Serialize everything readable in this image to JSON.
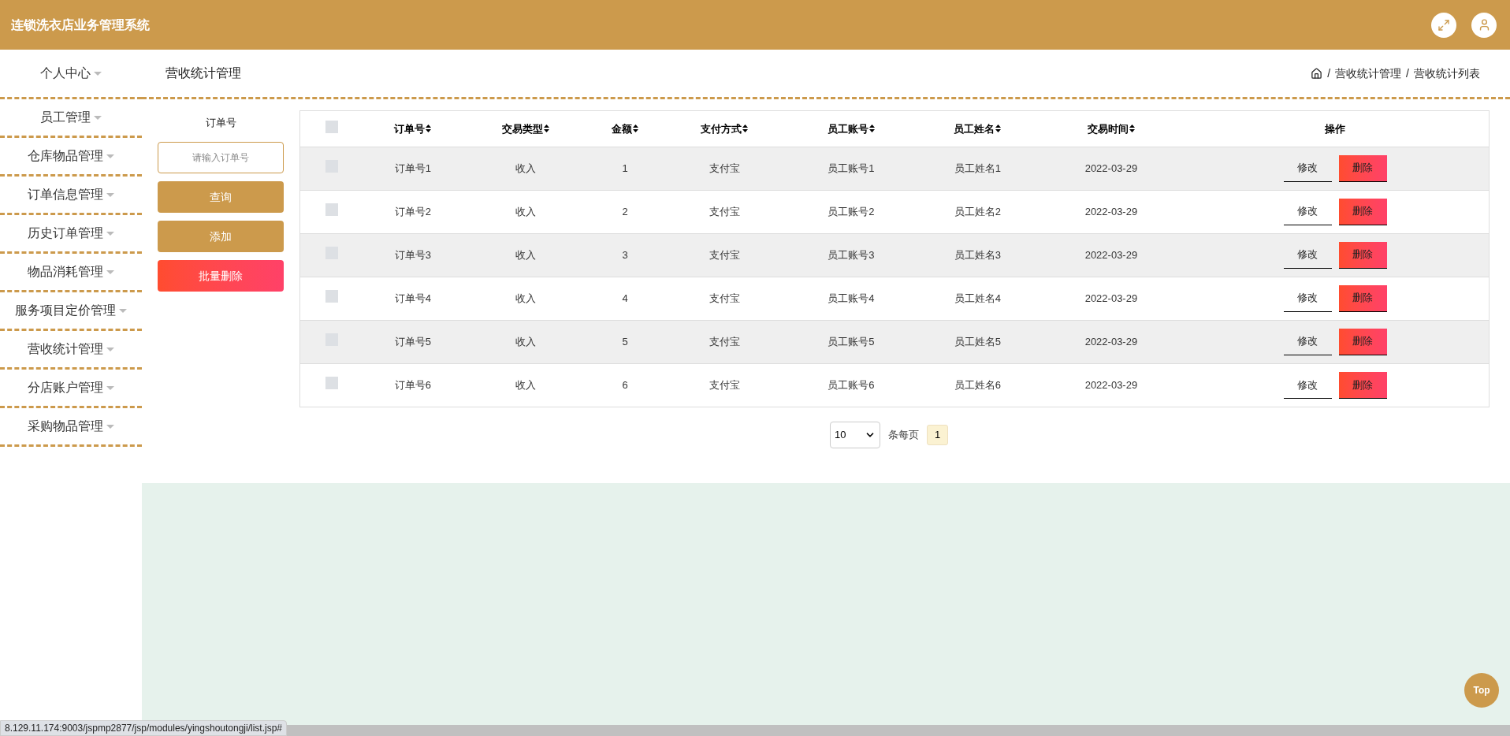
{
  "header": {
    "title": "连锁洗衣店业务管理系统"
  },
  "sidebar": {
    "items": [
      {
        "label": "个人中心"
      },
      {
        "label": "员工管理"
      },
      {
        "label": "仓库物品管理"
      },
      {
        "label": "订单信息管理"
      },
      {
        "label": "历史订单管理"
      },
      {
        "label": "物品消耗管理"
      },
      {
        "label": "服务项目定价管理"
      },
      {
        "label": "营收统计管理"
      },
      {
        "label": "分店账户管理"
      },
      {
        "label": "采购物品管理"
      }
    ]
  },
  "page_title": "营收统计管理",
  "breadcrumb": [
    {
      "separator": "/",
      "label": "营收统计管理"
    },
    {
      "separator": "/",
      "label": "营收统计列表"
    }
  ],
  "filter": {
    "label": "订单号",
    "placeholder": "请输入订单号",
    "buttons": [
      {
        "label": "查询",
        "kind": "primary"
      },
      {
        "label": "添加",
        "kind": "primary"
      },
      {
        "label": "批量删除",
        "kind": "danger"
      }
    ]
  },
  "table": {
    "select_all_checked": false,
    "columns": [
      "订单号",
      "交易类型",
      "金额",
      "支付方式",
      "员工账号",
      "员工姓名",
      "交易时间"
    ],
    "action_column": "操作",
    "rows": [
      {
        "checked": false,
        "cells": [
          "订单号1",
          "收入",
          "1",
          "支付宝",
          "员工账号1",
          "员工姓名1",
          "2022-03-29"
        ],
        "actions": [
          "修改",
          "删除"
        ]
      },
      {
        "checked": false,
        "cells": [
          "订单号2",
          "收入",
          "2",
          "支付宝",
          "员工账号2",
          "员工姓名2",
          "2022-03-29"
        ],
        "actions": [
          "修改",
          "删除"
        ]
      },
      {
        "checked": false,
        "cells": [
          "订单号3",
          "收入",
          "3",
          "支付宝",
          "员工账号3",
          "员工姓名3",
          "2022-03-29"
        ],
        "actions": [
          "修改",
          "删除"
        ]
      },
      {
        "checked": false,
        "cells": [
          "订单号4",
          "收入",
          "4",
          "支付宝",
          "员工账号4",
          "员工姓名4",
          "2022-03-29"
        ],
        "actions": [
          "修改",
          "删除"
        ]
      },
      {
        "checked": false,
        "cells": [
          "订单号5",
          "收入",
          "5",
          "支付宝",
          "员工账号5",
          "员工姓名5",
          "2022-03-29"
        ],
        "actions": [
          "修改",
          "删除"
        ]
      },
      {
        "checked": false,
        "cells": [
          "订单号6",
          "收入",
          "6",
          "支付宝",
          "员工账号6",
          "员工姓名6",
          "2022-03-29"
        ],
        "actions": [
          "修改",
          "删除"
        ]
      }
    ]
  },
  "pagination": {
    "page_size": "10",
    "per_page_label": "条每页",
    "pages": [
      {
        "label": "1",
        "selected": true
      }
    ]
  },
  "top_button": "Top",
  "status_bar": {
    "url": "8.129.11.174:9003/jspmp2877/jsp/modules/yingshoutongji/list.jsp#"
  }
}
